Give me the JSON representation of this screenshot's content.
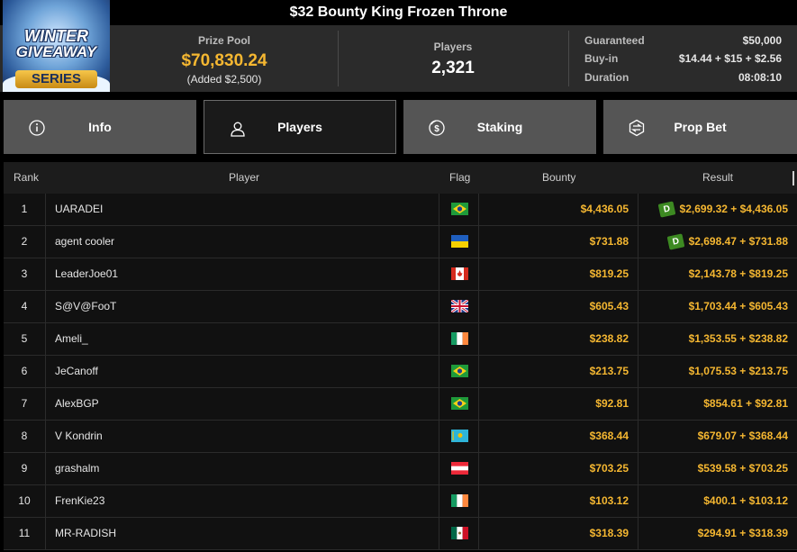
{
  "title": "$32 Bounty King Frozen Throne",
  "logo": {
    "line1": "WINTER",
    "line2": "GIVEAWAY",
    "line3": "SERIES"
  },
  "prize_pool": {
    "label": "Prize Pool",
    "value": "$70,830.24",
    "added": "(Added $2,500)"
  },
  "players_count": {
    "label": "Players",
    "value": "2,321"
  },
  "details": [
    {
      "key": "Guaranteed",
      "value": "$50,000"
    },
    {
      "key": "Buy-in",
      "value": "$14.44 + $15 + $2.56"
    },
    {
      "key": "Duration",
      "value": "08:08:10"
    }
  ],
  "tabs": [
    {
      "label": "Info",
      "icon": "info-icon"
    },
    {
      "label": "Players",
      "icon": "user-icon",
      "active": true
    },
    {
      "label": "Staking",
      "icon": "staking-coin-icon"
    },
    {
      "label": "Prop Bet",
      "icon": "prop-bet-icon"
    }
  ],
  "columns": {
    "rank": "Rank",
    "player": "Player",
    "flag": "Flag",
    "bounty": "Bounty",
    "result": "Result"
  },
  "rows": [
    {
      "rank": "1",
      "player": "UARADEI",
      "flag": "brazil",
      "bounty": "$4,436.05",
      "result": "$2,699.32 + $4,436.05",
      "badge": "D"
    },
    {
      "rank": "2",
      "player": "agent cooler",
      "flag": "ukraine",
      "bounty": "$731.88",
      "result": "$2,698.47 + $731.88",
      "badge": "D"
    },
    {
      "rank": "3",
      "player": "LeaderJoe01",
      "flag": "canada",
      "bounty": "$819.25",
      "result": "$2,143.78 + $819.25"
    },
    {
      "rank": "4",
      "player": "S@V@FooT",
      "flag": "uk",
      "bounty": "$605.43",
      "result": "$1,703.44 + $605.43"
    },
    {
      "rank": "5",
      "player": "Ameli_",
      "flag": "ireland",
      "bounty": "$238.82",
      "result": "$1,353.55 + $238.82"
    },
    {
      "rank": "6",
      "player": "JeCanoff",
      "flag": "brazil",
      "bounty": "$213.75",
      "result": "$1,075.53 + $213.75"
    },
    {
      "rank": "7",
      "player": "AlexBGP",
      "flag": "brazil",
      "bounty": "$92.81",
      "result": "$854.61 + $92.81"
    },
    {
      "rank": "8",
      "player": "V Kondrin",
      "flag": "kazakhstan",
      "bounty": "$368.44",
      "result": "$679.07 + $368.44"
    },
    {
      "rank": "9",
      "player": "grashalm",
      "flag": "austria",
      "bounty": "$703.25",
      "result": "$539.58 + $703.25"
    },
    {
      "rank": "10",
      "player": "FrenKie23",
      "flag": "ireland",
      "bounty": "$103.12",
      "result": "$400.1 + $103.12"
    },
    {
      "rank": "11",
      "player": "MR-RADISH",
      "flag": "mexico",
      "bounty": "$318.39",
      "result": "$294.91 + $318.39"
    }
  ],
  "colors": {
    "accent_gold": "#f5b731",
    "badge_green": "#3d8a22",
    "background": "#000000",
    "header": "#2b2b2b"
  }
}
